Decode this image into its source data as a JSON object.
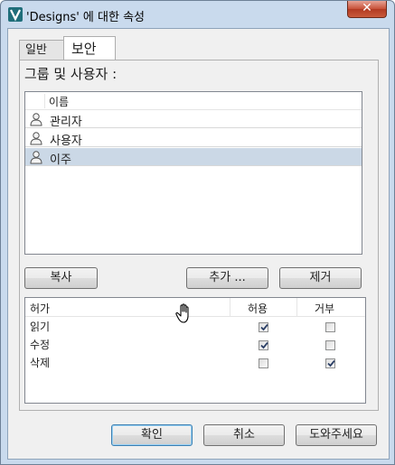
{
  "window": {
    "title": "'Designs' 에 대한 속성",
    "close_label": "✕"
  },
  "tabs": [
    {
      "label": "일반"
    },
    {
      "label": "보안"
    }
  ],
  "groups": {
    "label": "그룹 및 사용자 :",
    "column_header": "이름",
    "users": [
      {
        "name": "관리자",
        "selected": false
      },
      {
        "name": "사용자",
        "selected": false
      },
      {
        "name": "이주",
        "selected": true
      }
    ]
  },
  "buttons": {
    "copy": "복사",
    "add": "추가 ...",
    "remove": "제거"
  },
  "permissions": {
    "headers": {
      "name": "허가",
      "allow": "허용",
      "deny": "거부"
    },
    "rows": [
      {
        "name": "읽기",
        "allow": true,
        "deny": false
      },
      {
        "name": "수정",
        "allow": true,
        "deny": false
      },
      {
        "name": "삭제",
        "allow": false,
        "deny": true
      }
    ]
  },
  "footer": {
    "ok": "확인",
    "cancel": "취소",
    "help": "도와주세요"
  },
  "colors": {
    "frame": "#c9daed",
    "selected_row": "#cbd8e6",
    "close_button": "#c75037"
  }
}
